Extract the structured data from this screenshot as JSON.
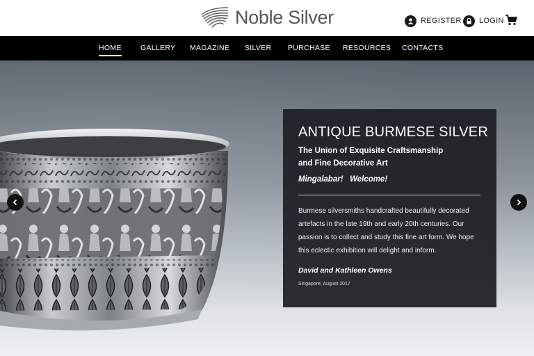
{
  "brand": {
    "name": "Noble Silver",
    "logo_icon": "striped-shell-logo"
  },
  "account": {
    "register_label": "REGISTER",
    "login_label": "LOGIN",
    "register_icon": "user-icon",
    "login_icon": "lock-icon",
    "cart_icon": "cart-icon"
  },
  "nav": {
    "items": [
      {
        "label": "HOME",
        "active": true
      },
      {
        "label": "GALLERY"
      },
      {
        "label": "MAGAZINE"
      },
      {
        "label": "SILVER"
      },
      {
        "label": "PURCHASE"
      },
      {
        "label": "RESOURCES"
      },
      {
        "label": "CONTACTS"
      }
    ]
  },
  "hero": {
    "image": "antique-burmese-silver-bowl",
    "prev_icon": "chevron-left-icon",
    "next_icon": "chevron-right-icon",
    "panel": {
      "title": "ANTIQUE BURMESE SILVER",
      "subtitle_line1": "The Union of Exquisite Craftsmanship",
      "subtitle_line2": "and Fine Decorative Art",
      "greeting": "Mingalabar!   Welcome!",
      "body": "Burmese silversmiths handcrafted beautifully decorated artefacts in the late 19th and early 20th centuries. Our passion is to collect and study this fine art form. We hope this eclectic exhibition will delight and inform.",
      "signature": "David and Kathleen Owens",
      "place_date": "Singapore, August 2017"
    }
  },
  "colors": {
    "nav_bg": "#000000",
    "panel_bg": "#1c1f22",
    "text_dark": "#222222"
  }
}
